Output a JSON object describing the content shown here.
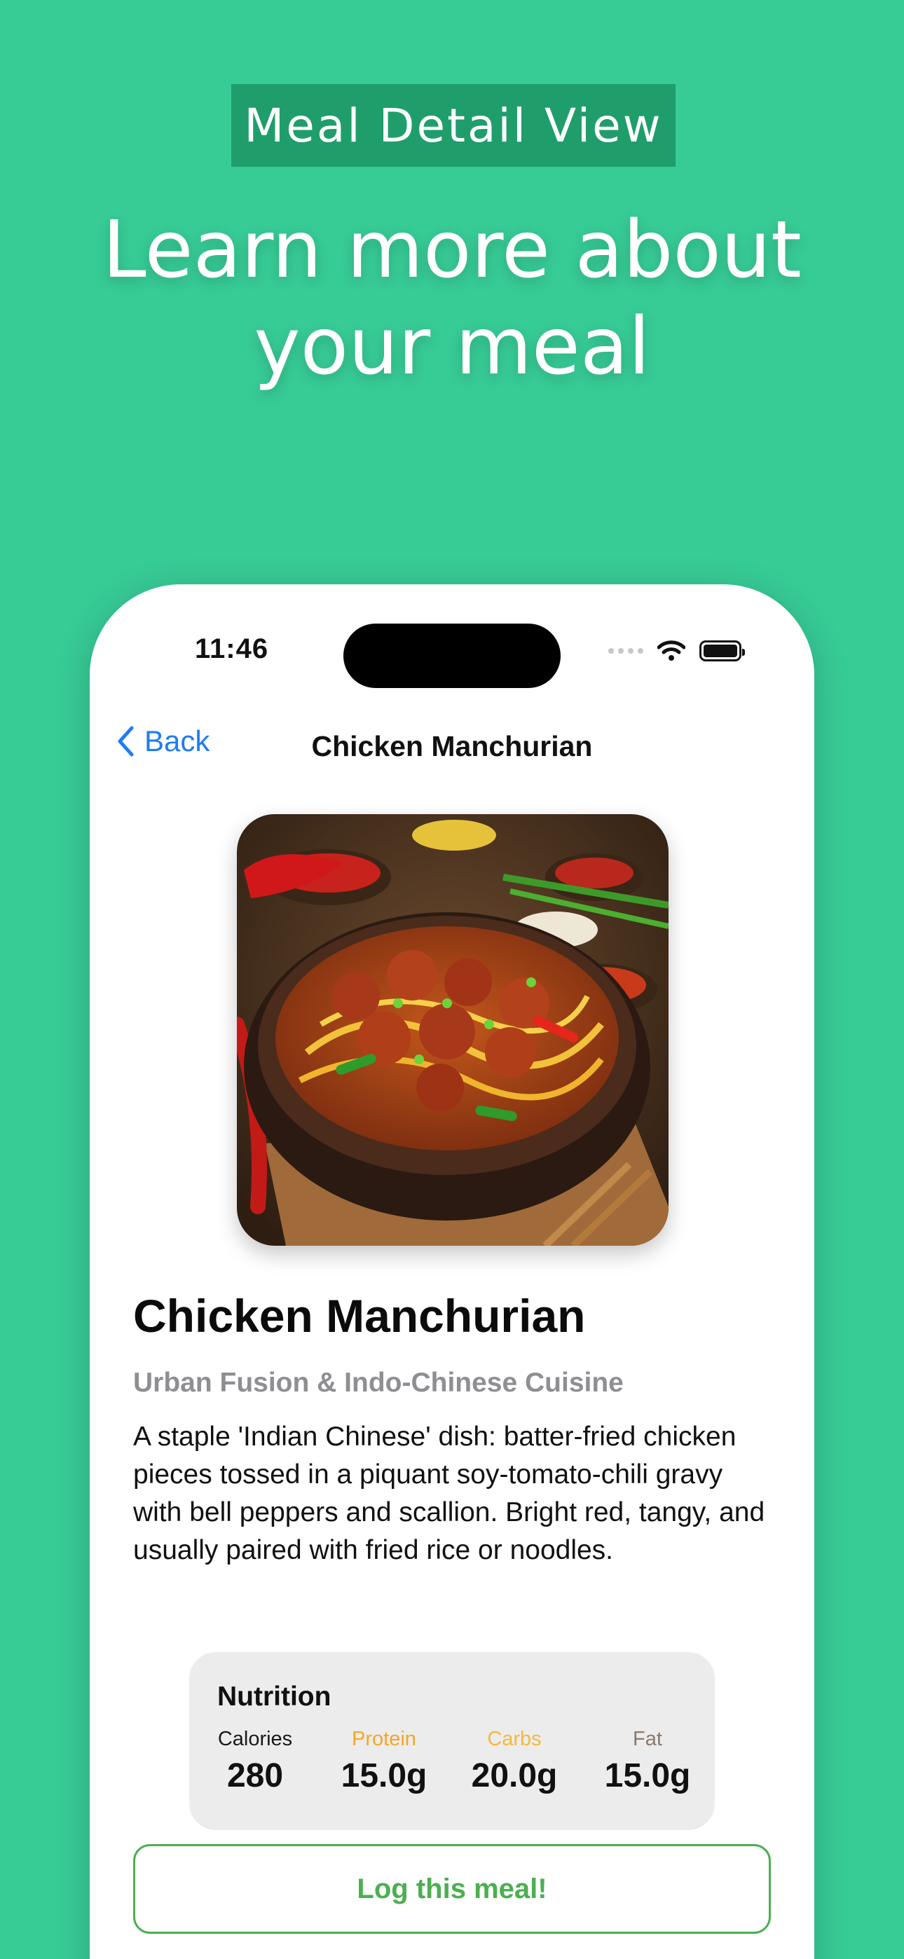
{
  "promo": {
    "badge": "Meal Detail View",
    "headline_line1": "Learn more about",
    "headline_line2": "your meal"
  },
  "status_bar": {
    "time": "11:46"
  },
  "nav": {
    "back_label": "Back",
    "title": "Chicken Manchurian"
  },
  "meal": {
    "name": "Chicken Manchurian",
    "cuisine": "Urban Fusion & Indo-Chinese Cuisine",
    "description": "A staple 'Indian Chinese' dish: batter-fried chicken pieces tossed in a piquant soy-tomato-chili gravy with bell peppers and scallion. Bright red, tangy, and usually paired with fried rice or noodles."
  },
  "nutrition": {
    "title": "Nutrition",
    "items": [
      {
        "label": "Calories",
        "value": "280",
        "color": "#1a1a1a"
      },
      {
        "label": "Protein",
        "value": "15.0g",
        "color": "#F5A623"
      },
      {
        "label": "Carbs",
        "value": "20.0g",
        "color": "#F5B93A"
      },
      {
        "label": "Fat",
        "value": "15.0g",
        "color": "#8A7A6A"
      }
    ]
  },
  "actions": {
    "log_meal": "Log this meal!"
  },
  "colors": {
    "background": "#37CB96",
    "badge": "#1F9E6B",
    "accent_blue": "#1E7CF2",
    "accent_green": "#4CAF50"
  }
}
